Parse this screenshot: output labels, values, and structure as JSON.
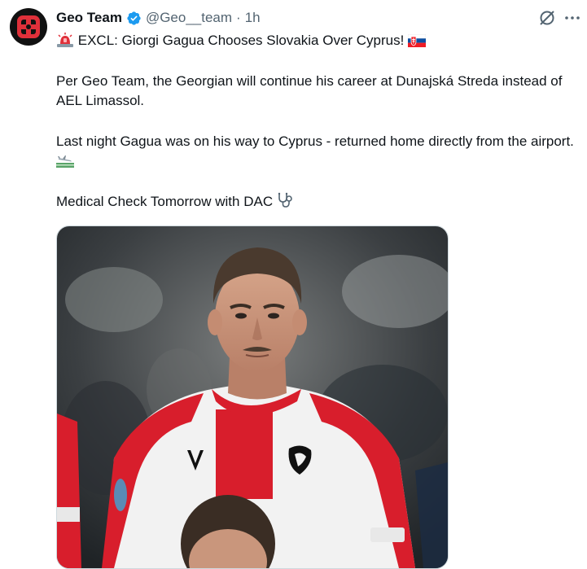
{
  "account": {
    "display_name": "Geo Team",
    "handle": "@Geo__team",
    "separator": "·",
    "time": "1h"
  },
  "tweet": {
    "line1_text": "EXCL: Giorgi Gagua Chooses Slovakia Over Cyprus!",
    "line2": "Per Geo Team, the Georgian will continue his career at Dunajská Streda instead of AEL Limassol.",
    "line3": "Last night Gagua was on his way to Cyprus - returned home directly from the airport.",
    "line4": "Medical Check Tomorrow with DAC"
  },
  "icons": {
    "avatar": "geo-team-logo",
    "verified": "verified-badge-icon",
    "grok": "grok-icon",
    "more": "more-icon",
    "siren": "siren-emoji",
    "flag": "slovakia-flag-emoji",
    "airplane": "airplane-landing-emoji",
    "stethoscope": "stethoscope-emoji"
  },
  "media": {
    "kind": "photo",
    "jersey_brand": "macron"
  },
  "colors": {
    "verified": "#1d9bf0",
    "text": "#0f1419",
    "muted": "#536471",
    "jersey_red": "#d81e2c",
    "logo_red": "#e0303a"
  }
}
